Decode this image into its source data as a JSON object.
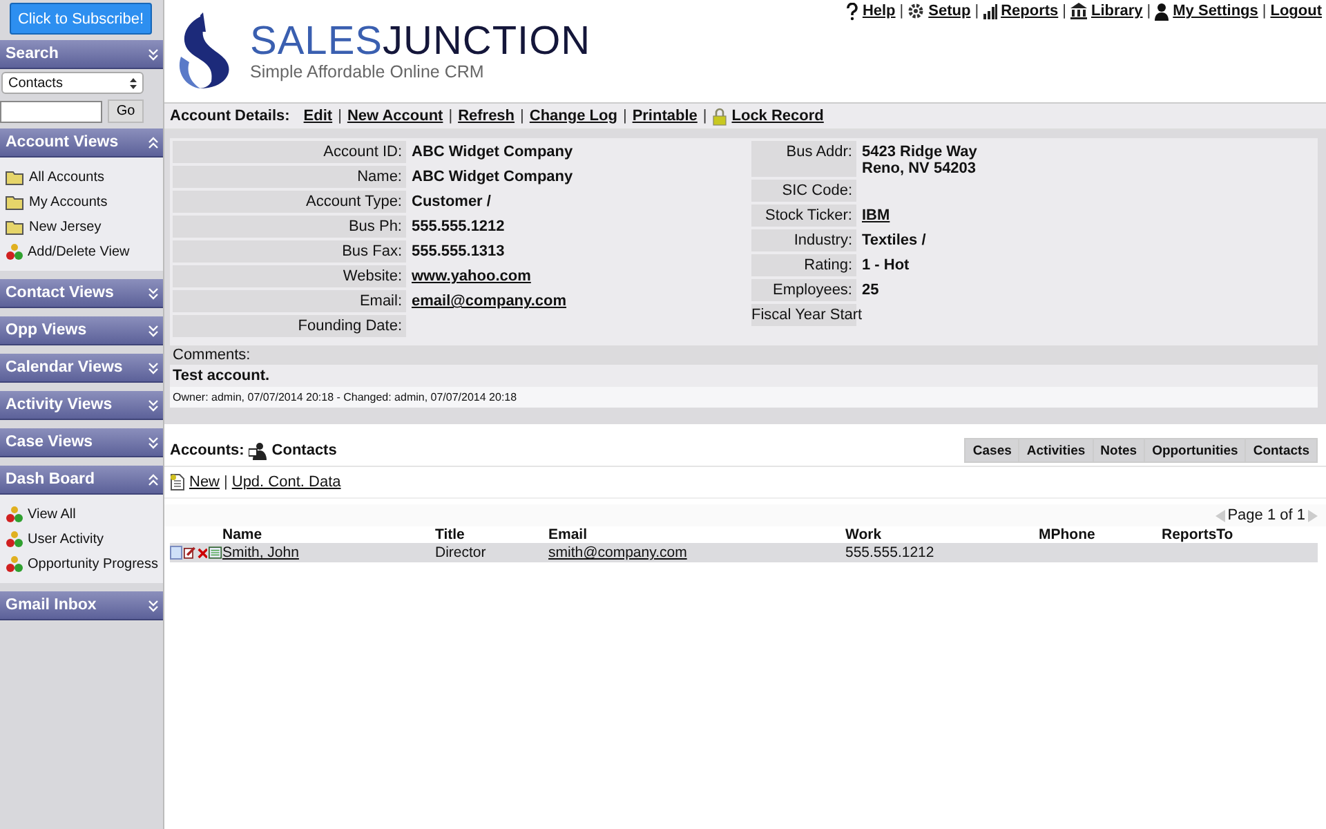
{
  "subscribe_button": "Click to Subscribe!",
  "search": {
    "title": "Search",
    "expanded": false,
    "select": "Contacts",
    "button": "Go"
  },
  "sidebar_sections": [
    {
      "title": "Account Views",
      "expanded": true,
      "items": [
        {
          "label": "All Accounts",
          "kind": "folder"
        },
        {
          "label": "My Accounts",
          "kind": "folder"
        },
        {
          "label": "New Jersey",
          "kind": "folder"
        },
        {
          "label": "Add/Delete View",
          "kind": "people"
        }
      ]
    },
    {
      "title": "Contact Views",
      "expanded": false
    },
    {
      "title": "Opp Views",
      "expanded": false
    },
    {
      "title": "Calendar Views",
      "expanded": false
    },
    {
      "title": "Activity Views",
      "expanded": false
    },
    {
      "title": "Case Views",
      "expanded": false
    },
    {
      "title": "Dash Board",
      "expanded": true,
      "items": [
        {
          "label": "View All",
          "kind": "people"
        },
        {
          "label": "User Activity",
          "kind": "people"
        },
        {
          "label": "Opportunity Progress",
          "kind": "people"
        }
      ]
    },
    {
      "title": "Gmail Inbox",
      "expanded": false
    }
  ],
  "logo": {
    "name_part_1": "SALES",
    "name_part_2": "JUNCTION",
    "tagline": "Simple Affordable Online CRM"
  },
  "top_links": [
    {
      "label": "Help",
      "kind": "help"
    },
    {
      "sep": "|",
      "label": "Setup",
      "kind": "gear"
    },
    {
      "sep": "|",
      "label": "Reports",
      "kind": "bars"
    },
    {
      "sep": "|",
      "label": "Library",
      "kind": "library"
    },
    {
      "sep": "|",
      "label": "My Settings",
      "kind": "user"
    },
    {
      "sep": "|",
      "label": "Logout",
      "kind": "plain"
    }
  ],
  "account_toolbar": {
    "title": "Account Details:",
    "links": [
      {
        "label": "Edit",
        "kind": "plain"
      },
      {
        "sep": "|",
        "label": "New Account",
        "kind": "plain"
      },
      {
        "sep": "|",
        "label": "Refresh",
        "kind": "plain"
      },
      {
        "sep": "|",
        "label": "Change Log",
        "kind": "plain"
      },
      {
        "sep": "|",
        "label": "Printable",
        "kind": "plain"
      },
      {
        "sep": "|",
        "label": "Lock Record",
        "kind": "lock"
      }
    ]
  },
  "details_left": [
    {
      "label": "Account ID:",
      "value": "ABC Widget Company",
      "link": false
    },
    {
      "label": "Name:",
      "value": "ABC Widget Company",
      "link": false
    },
    {
      "label": "Account Type:",
      "value": "Customer /",
      "link": false
    },
    {
      "label": "Bus Ph:",
      "value": "555.555.1212",
      "link": false
    },
    {
      "label": "Bus Fax:",
      "value": "555.555.1313",
      "link": false
    },
    {
      "label": "Website:",
      "value": "www.yahoo.com",
      "link": true
    },
    {
      "label": "Email:",
      "value": "email@company.com",
      "link": true
    },
    {
      "label": "Founding Date:"
    }
  ],
  "details_right": [
    {
      "label": "Bus Addr:",
      "value": "5423 Ridge Way",
      "value_line_2": "Reno, NV 54203",
      "link": false
    },
    {
      "label": "SIC Code:"
    },
    {
      "label": "Stock Ticker:",
      "value": "IBM",
      "link": true
    },
    {
      "label": "Industry:",
      "value": "Textiles /",
      "link": false
    },
    {
      "label": "Rating:",
      "value": "1 - Hot",
      "link": false
    },
    {
      "label": "Employees:",
      "value": "25",
      "link": false
    },
    {
      "label": "Fiscal Year Start"
    }
  ],
  "comments": {
    "label": "Comments:",
    "text": "Test account.",
    "audit": "Owner: admin, 07/07/2014 20:18 - Changed: admin, 07/07/2014 20:18"
  },
  "related": {
    "prefix": "Accounts:",
    "title": "Contacts",
    "tabs": [
      {
        "label": "Cases",
        "selected": false
      },
      {
        "label": "Activities",
        "selected": false
      },
      {
        "label": "Notes",
        "selected": false
      },
      {
        "label": "Opportunities",
        "selected": false
      },
      {
        "label": "Contacts",
        "selected": false
      }
    ],
    "actions": [
      {
        "label": "New"
      },
      {
        "sep": "|",
        "label": "Upd. Cont. Data"
      }
    ],
    "pager": "Page 1 of 1",
    "columns": [
      "Name",
      "Title",
      "Email",
      "Work",
      "MPhone",
      "ReportsTo"
    ],
    "rows": [
      {
        "checked": false,
        "name": "Smith, John",
        "title": "Director",
        "email": "smith@company.com",
        "work": "555.555.1212"
      }
    ]
  }
}
